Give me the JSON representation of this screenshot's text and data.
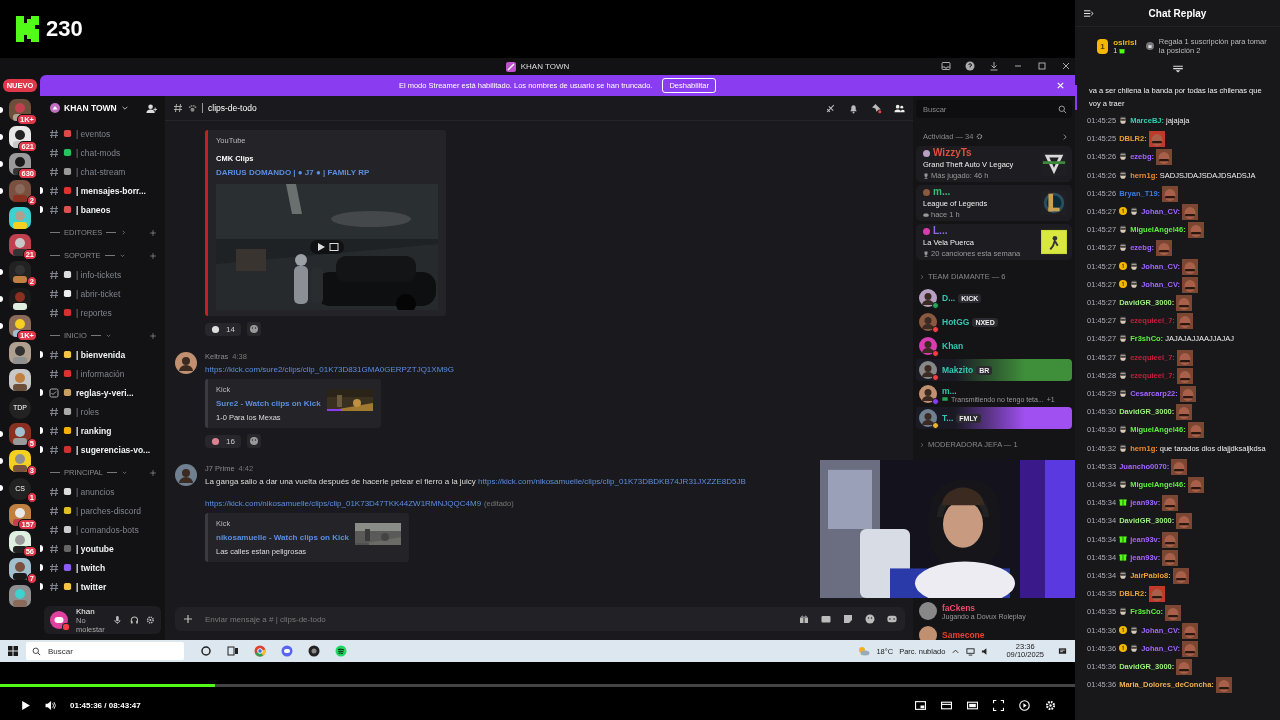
{
  "stream": {
    "viewers": "230"
  },
  "window": {
    "title": "KHAN TOWN"
  },
  "servers": {
    "new_label": "NUEVO",
    "items": [
      {
        "kind": "picture",
        "badge": "1K+",
        "unread": true
      },
      {
        "kind": "picture",
        "badge": "621",
        "unread": true
      },
      {
        "kind": "picture",
        "badge": "630",
        "unread": true
      },
      {
        "kind": "picture",
        "badge": "2",
        "unread": true
      },
      {
        "kind": "picture",
        "unread": false
      },
      {
        "kind": "picture",
        "badge": "21",
        "unread": false
      },
      {
        "kind": "picture",
        "badge": "2",
        "unread": true
      },
      {
        "kind": "picture",
        "unread": true
      },
      {
        "kind": "picture",
        "badge": "1K+",
        "unread": true
      },
      {
        "kind": "picture",
        "unread": false
      },
      {
        "kind": "picture",
        "unread": false
      },
      {
        "kind": "text",
        "label": "TDP",
        "unread": false
      },
      {
        "kind": "picture",
        "badge": "5",
        "unread": true
      },
      {
        "kind": "picture",
        "badge": "3",
        "unread": true
      },
      {
        "kind": "text",
        "label": "CS",
        "badge": "1",
        "unread": true
      },
      {
        "kind": "picture",
        "badge": "157",
        "unread": false
      },
      {
        "kind": "picture",
        "badge": "56",
        "unread": false
      },
      {
        "kind": "picture",
        "badge": "7",
        "unread": false
      },
      {
        "kind": "picture",
        "unread": false
      }
    ]
  },
  "banner": {
    "text": "El modo Streamer está habilitado. Los nombres de usuario se han truncado.",
    "button": "Deshabilitar"
  },
  "server_name": "KHAN TOWN",
  "channels": [
    {
      "kind": "channel",
      "name": "| eventos",
      "unread": false,
      "color": "#e04848"
    },
    {
      "kind": "channel",
      "name": "| chat-mods",
      "unread": false,
      "color": "#22c55e"
    },
    {
      "kind": "channel",
      "name": "| chat-stream",
      "unread": false,
      "color": "#9a9a9a"
    },
    {
      "kind": "channel",
      "name": "| mensajes-borr...",
      "unread": true,
      "color": "#e03030"
    },
    {
      "kind": "channel",
      "name": "| baneos",
      "unread": true,
      "color": "#e05050"
    },
    {
      "kind": "category",
      "name": "EDITORES",
      "expanded": false
    },
    {
      "kind": "category",
      "name": "SOPORTE",
      "expanded": true
    },
    {
      "kind": "channel",
      "name": "| info-tickets",
      "unread": false,
      "color": "#dddddd"
    },
    {
      "kind": "channel",
      "name": "| abrir-ticket",
      "unread": false,
      "color": "#eeeeee"
    },
    {
      "kind": "channel",
      "name": "| reportes",
      "unread": false,
      "color": "#d83030"
    },
    {
      "kind": "category",
      "name": "INICIO",
      "expanded": true
    },
    {
      "kind": "channel",
      "name": "| bienvenida",
      "unread": true,
      "color": "#f5c542"
    },
    {
      "kind": "channel",
      "name": "| información",
      "unread": false,
      "color": "#e03030"
    },
    {
      "kind": "rules",
      "name": "reglas-y-veri...",
      "unread": true,
      "color": "#c8a060"
    },
    {
      "kind": "channel",
      "name": "| roles",
      "unread": false,
      "color": "#aaaaaa"
    },
    {
      "kind": "channel",
      "name": "| ranking",
      "unread": true,
      "color": "#f5b000"
    },
    {
      "kind": "channel",
      "name": "| sugerencias-vo...",
      "unread": true,
      "color": "#d03030"
    },
    {
      "kind": "category",
      "name": "PRINCIPAL",
      "expanded": true
    },
    {
      "kind": "channel",
      "name": "| anuncios",
      "unread": false,
      "color": "#dddddd"
    },
    {
      "kind": "channel",
      "name": "| parches-discord",
      "unread": false,
      "color": "#e0c020"
    },
    {
      "kind": "channel",
      "name": "| comandos-bots",
      "unread": false,
      "color": "#cccccc"
    },
    {
      "kind": "channel",
      "name": "| youtube",
      "unread": true,
      "color": "#666666"
    },
    {
      "kind": "channel",
      "name": "| twitch",
      "unread": true,
      "color": "#8b5cf6"
    },
    {
      "kind": "channel",
      "name": "| twitter",
      "unread": true,
      "color": "#f5c542"
    }
  ],
  "user": {
    "name": "Khan",
    "status": "No molestar"
  },
  "chat": {
    "channel": "clips-de-todo",
    "input": {
      "placeholder": "Enviar mensaje a # | clips-de-todo"
    },
    "messages": [
      {
        "kind": "continuation",
        "embed": {
          "kind": "video",
          "provider": "YouTube",
          "author": "CMK Clips",
          "title": "DARIUS DOMANDO | ● J7 ● | FAMILY RP",
          "color": "#c4221f"
        },
        "reactions": [
          {
            "count": "14"
          }
        ]
      },
      {
        "kind": "message",
        "author": "Keltras",
        "time": "4:38",
        "lines": [
          [
            {
              "kind": "link",
              "value": "https://kick.com/sure2/clips/clip_01K73D831GMA0GERPZTJQ1XM9G"
            }
          ]
        ],
        "embed": {
          "kind": "thumbnail",
          "provider": "Kick",
          "title": "Sure2 - Watch clips on Kick",
          "description": "1-0 Para los Mexas",
          "color": "#3a3a40"
        },
        "reactions": [
          {
            "count": "16"
          }
        ]
      },
      {
        "kind": "message",
        "author": "J7 Prime",
        "time": "4:42",
        "lines": [
          [
            {
              "kind": "text",
              "value": "La ganga salio a dar una vuelta después de hacerle petear el fierro a la juicy "
            },
            {
              "kind": "link",
              "value": "https://kick.com/nikosamuelle/clips/clip_01K73DBDKB74JR31JXZZE8D5JB"
            }
          ],
          [
            {
              "kind": "link",
              "value": "https://kick.com/nikosamuelle/clips/clip_01K73D47TKK44ZW1RMNJQQC4M9"
            },
            {
              "kind": "note",
              "value": "(editado)"
            }
          ]
        ],
        "embed": {
          "kind": "thumbnail",
          "provider": "Kick",
          "title": "nikosamuelle - Watch clips on Kick",
          "description": "Las calles estan peligrosas",
          "color": "#3a3a40"
        }
      }
    ]
  },
  "members": {
    "search_placeholder": "Buscar",
    "activity_label": "Actividad — 34",
    "activities": [
      {
        "kind": "trophy",
        "user": "WizzyTs",
        "color": "#e0503c",
        "title": "Grand Theft Auto V Legacy",
        "detail": "Más jugado: 46 h"
      },
      {
        "kind": "gamepad",
        "user": "m...",
        "color": "#2fc070",
        "title": "League of Legends",
        "detail": "hace 1 h"
      },
      {
        "kind": "trophy",
        "user": "L...",
        "color": "#8a6af0",
        "title": "La Vela Puerca",
        "detail": "20 canciones esta semana"
      }
    ],
    "groups": [
      {
        "label": "TEAM DIAMANTE — 6",
        "members": [
          {
            "name": "D...",
            "tag": "KICK",
            "color": "#23a55a"
          },
          {
            "name": "HotGG",
            "tag": "NXED",
            "color": "#f23f43"
          },
          {
            "name": "Khan",
            "color": "#f23f43"
          },
          {
            "name": "Makzito",
            "tag": "BR",
            "color": "#f23f43",
            "banner": {
              "color": "#3f8f3a"
            }
          },
          {
            "name": "m...",
            "color": "#8a3cf0",
            "activity": "Transmitiendo no tengo teta...",
            "extra": "+1"
          },
          {
            "name": "T...",
            "tag": "FMLY",
            "color": "#f0b232",
            "banner": {
              "color": "#a050f0"
            }
          }
        ]
      },
      {
        "label": "MODERADORA JEFA — 1"
      }
    ],
    "below": [
      {
        "name": "faCkens",
        "color": "#e84a6a",
        "activity": "Jugando a Dovux Roleplay"
      },
      {
        "name": "Samecone",
        "color": "#e8402a"
      }
    ]
  },
  "taskbar": {
    "search_placeholder": "Buscar",
    "temperature": "18°C",
    "weather": "Parc. nublado",
    "time": "23:36",
    "date": "09/10/2025"
  },
  "player": {
    "time": "01:45:36 / 08:43:47",
    "level": 0.2
  },
  "replay": {
    "title": "Chat Replay",
    "leader": {
      "rank": "1",
      "name": "osirisl",
      "count": "1",
      "cta": "Regala 1 suscripción para tomar la posición 2"
    },
    "pinned_text": "va a ser chilena la banda por todas las chilenas que voy a traer",
    "messages": [
      {
        "time": "01:45:25",
        "badges": [
          {
            "kind": "mask"
          }
        ],
        "user": "MarceBJ:",
        "color": "#2fd0b0",
        "text": "jajajaja"
      },
      {
        "time": "01:45:25",
        "user": "DBLR2:",
        "color": "#f0a030",
        "emote": {
          "color": "#c0392b"
        }
      },
      {
        "time": "01:45:26",
        "badges": [
          {
            "kind": "mask"
          }
        ],
        "user": "ezebg:",
        "color": "#a365ff",
        "emote": {
          "color": "#7b4632"
        }
      },
      {
        "time": "01:45:26",
        "badges": [
          {
            "kind": "mask"
          }
        ],
        "user": "hern1g:",
        "color": "#f08c30",
        "text": "SADJSJDAJSDAJDSADSJA"
      },
      {
        "time": "01:45:26",
        "user": "Bryan_T19:",
        "color": "#3b7be0",
        "emote": {
          "color": "#7b4632"
        }
      },
      {
        "time": "01:45:27",
        "badges": [
          {
            "kind": "gifter"
          },
          {
            "kind": "mask"
          }
        ],
        "user": "Johan_CV:",
        "color": "#a365ff",
        "emote": {
          "color": "#7b4632"
        }
      },
      {
        "time": "01:45:27",
        "badges": [
          {
            "kind": "mask"
          }
        ],
        "user": "MiguelAngel46:",
        "color": "#5ff03f",
        "emote": {
          "color": "#7b4632"
        }
      },
      {
        "time": "01:45:27",
        "badges": [
          {
            "kind": "mask"
          }
        ],
        "user": "ezebg:",
        "color": "#a365ff",
        "emote": {
          "color": "#7b4632"
        }
      },
      {
        "time": "01:45:27",
        "badges": [
          {
            "kind": "gifter"
          },
          {
            "kind": "mask"
          }
        ],
        "user": "Johan_CV:",
        "color": "#a365ff",
        "emote": {
          "color": "#7b4632"
        }
      },
      {
        "time": "01:45:27",
        "badges": [
          {
            "kind": "gifter"
          },
          {
            "kind": "mask"
          }
        ],
        "user": "Johan_CV:",
        "color": "#a365ff",
        "emote": {
          "color": "#7b4632"
        }
      },
      {
        "time": "01:45:27",
        "user": "DavidGR_3000:",
        "color": "#9cf07a",
        "emote": {
          "color": "#7b4632"
        }
      },
      {
        "time": "01:45:27",
        "badges": [
          {
            "kind": "mask"
          }
        ],
        "user": "ezequieel_7:",
        "color": "#c0203a",
        "emote": {
          "color": "#7b4632"
        }
      },
      {
        "time": "01:45:27",
        "badges": [
          {
            "kind": "mask"
          }
        ],
        "user": "Fr3shCo:",
        "color": "#5ff03f",
        "text": "JAJAJAJJAAJJAJAJ"
      },
      {
        "time": "01:45:27",
        "badges": [
          {
            "kind": "mask"
          }
        ],
        "user": "ezequieel_7:",
        "color": "#c0203a",
        "emote": {
          "color": "#7b4632"
        }
      },
      {
        "time": "01:45:28",
        "badges": [
          {
            "kind": "mask"
          }
        ],
        "user": "ezequieel_7:",
        "color": "#c0203a",
        "emote": {
          "color": "#7b4632"
        }
      },
      {
        "time": "01:45:29",
        "badges": [
          {
            "kind": "mask"
          }
        ],
        "user": "Cesarcarp22:",
        "color": "#a365ff",
        "emote": {
          "color": "#7b4632"
        }
      },
      {
        "time": "01:45:30",
        "user": "DavidGR_3000:",
        "color": "#9cf07a",
        "emote": {
          "color": "#7b4632"
        }
      },
      {
        "time": "01:45:30",
        "badges": [
          {
            "kind": "mask"
          }
        ],
        "user": "MiguelAngel46:",
        "color": "#5ff03f",
        "emote": {
          "color": "#7b4632"
        }
      },
      {
        "time": "01:45:32",
        "badges": [
          {
            "kind": "mask"
          }
        ],
        "user": "hern1g:",
        "color": "#f08c30",
        "text": "que tarados dios dlajjdksaljkdsa"
      },
      {
        "time": "01:45:33",
        "user": "Juancho0070:",
        "color": "#a365ff",
        "emote": {
          "color": "#7b4632"
        }
      },
      {
        "time": "01:45:34",
        "badges": [
          {
            "kind": "mask"
          }
        ],
        "user": "MiguelAngel46:",
        "color": "#5ff03f",
        "emote": {
          "color": "#7b4632"
        }
      },
      {
        "time": "01:45:34",
        "badges": [
          {
            "kind": "sub"
          }
        ],
        "user": "jean93v:",
        "color": "#a365ff",
        "emote": {
          "color": "#7b4632"
        }
      },
      {
        "time": "01:45:34",
        "user": "DavidGR_3000:",
        "color": "#9cf07a",
        "emote": {
          "color": "#7b4632"
        }
      },
      {
        "time": "01:45:34",
        "badges": [
          {
            "kind": "sub"
          }
        ],
        "user": "jean93v:",
        "color": "#a365ff",
        "emote": {
          "color": "#7b4632"
        }
      },
      {
        "time": "01:45:34",
        "badges": [
          {
            "kind": "sub"
          }
        ],
        "user": "jean93v:",
        "color": "#a365ff",
        "emote": {
          "color": "#7b4632"
        }
      },
      {
        "time": "01:45:34",
        "badges": [
          {
            "kind": "mask"
          }
        ],
        "user": "JairPablo8:",
        "color": "#f0a030",
        "emote": {
          "color": "#7b4632"
        }
      },
      {
        "time": "01:45:35",
        "user": "DBLR2:",
        "color": "#f0a030",
        "emote": {
          "color": "#c0392b"
        }
      },
      {
        "time": "01:45:35",
        "badges": [
          {
            "kind": "mask"
          }
        ],
        "user": "Fr3shCo:",
        "color": "#5ff03f",
        "emote": {
          "color": "#7b4632"
        }
      },
      {
        "time": "01:45:36",
        "badges": [
          {
            "kind": "gifter"
          },
          {
            "kind": "mask"
          }
        ],
        "user": "Johan_CV:",
        "color": "#a365ff",
        "emote": {
          "color": "#7b4632"
        }
      },
      {
        "time": "01:45:36",
        "badges": [
          {
            "kind": "gifter"
          },
          {
            "kind": "mask"
          }
        ],
        "user": "Johan_CV:",
        "color": "#a365ff",
        "emote": {
          "color": "#7b4632"
        }
      },
      {
        "time": "01:45:36",
        "user": "DavidGR_3000:",
        "color": "#9cf07a",
        "emote": {
          "color": "#7b4632"
        }
      },
      {
        "time": "01:45:36",
        "user": "Maria_Dolores_deConcha:",
        "color": "#f0b050",
        "emote": {
          "color": "#7b4632"
        }
      }
    ]
  }
}
